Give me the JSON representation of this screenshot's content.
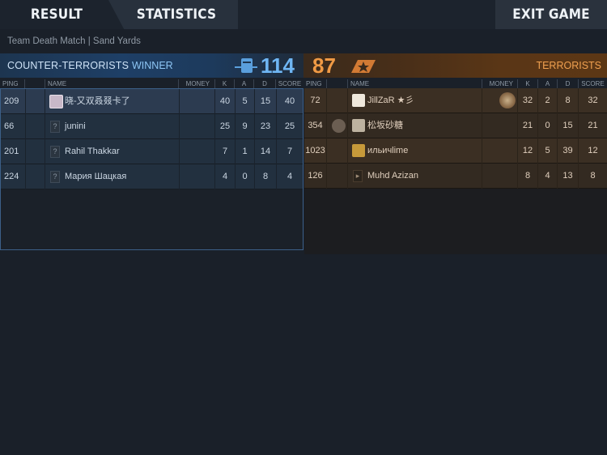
{
  "tabs": {
    "result": "RESULT",
    "statistics": "STATISTICS",
    "exit": "EXIT GAME"
  },
  "match": {
    "subtitle": "Team Death Match | Sand Yards"
  },
  "ct": {
    "name": "COUNTER-TERRORISTS",
    "winner": "WINNER",
    "score": "114"
  },
  "t": {
    "name": "TERRORISTS",
    "score": "87"
  },
  "headers": {
    "ping": "PING",
    "name": "NAME",
    "money": "MONEY",
    "k": "K",
    "a": "A",
    "d": "D",
    "score": "SCORE"
  },
  "ct_players": [
    {
      "ping": "209",
      "name": "晓-又双叒叕卡了",
      "money": "",
      "k": "40",
      "a": "5",
      "d": "15",
      "score": "40"
    },
    {
      "ping": "66",
      "name": "junini",
      "money": "",
      "k": "25",
      "a": "9",
      "d": "23",
      "score": "25"
    },
    {
      "ping": "201",
      "name": "Rahil Thakkar",
      "money": "",
      "k": "7",
      "a": "1",
      "d": "14",
      "score": "7"
    },
    {
      "ping": "224",
      "name": "Мария Шацкая",
      "money": "",
      "k": "4",
      "a": "0",
      "d": "8",
      "score": "4"
    }
  ],
  "t_players": [
    {
      "ping": "72",
      "name": "JillZaR ★彡",
      "money": "",
      "k": "32",
      "a": "2",
      "d": "8",
      "score": "32"
    },
    {
      "ping": "354",
      "name": "松坂砂糖",
      "money": "",
      "k": "21",
      "a": "0",
      "d": "15",
      "score": "21"
    },
    {
      "ping": "1023",
      "name": "ильичlime",
      "money": "",
      "k": "12",
      "a": "5",
      "d": "39",
      "score": "12"
    },
    {
      "ping": "126",
      "name": "Muhd Azizan",
      "money": "",
      "k": "8",
      "a": "4",
      "d": "13",
      "score": "8"
    }
  ],
  "colors": {
    "ct_accent": "#6fb6f4",
    "t_accent": "#f09a45",
    "background": "#1a2029"
  }
}
